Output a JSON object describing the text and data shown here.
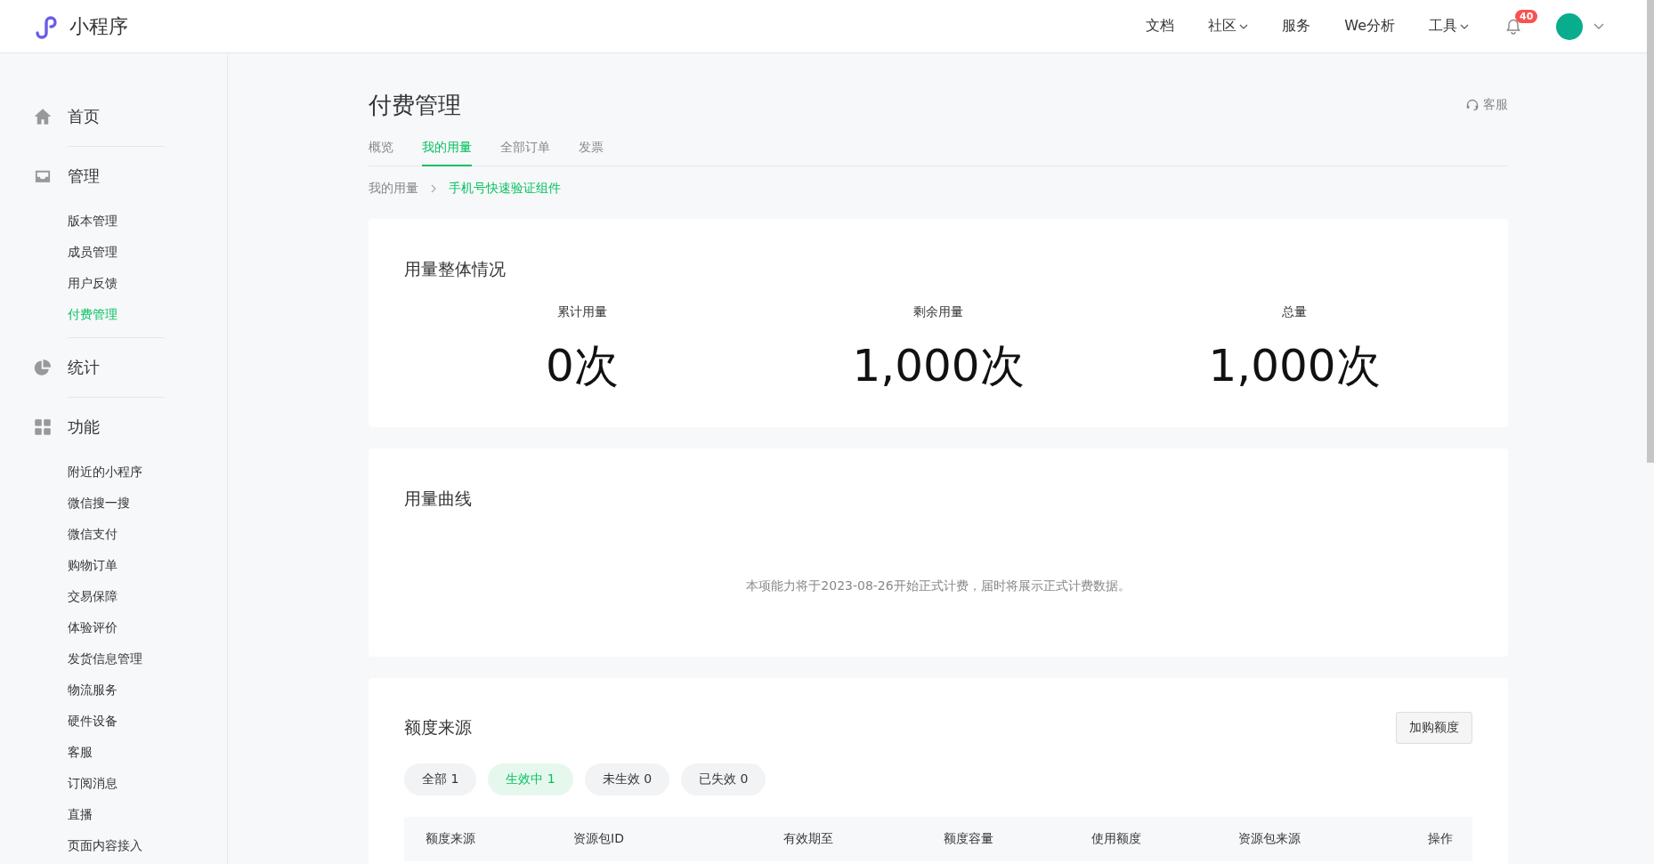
{
  "top_bar": {
    "brand": "小程序",
    "nav": [
      {
        "label": "文档",
        "has_menu": false
      },
      {
        "label": "社区",
        "has_menu": true
      },
      {
        "label": "服务",
        "has_menu": false
      },
      {
        "label": "We分析",
        "has_menu": false
      },
      {
        "label": "工具",
        "has_menu": true
      }
    ],
    "notification_count": "40"
  },
  "sidebar": {
    "sections": [
      {
        "label": "首页",
        "selected": false
      },
      {
        "label": "管理",
        "selected": false,
        "items": [
          {
            "label": "版本管理",
            "selected": false
          },
          {
            "label": "成员管理",
            "selected": false
          },
          {
            "label": "用户反馈",
            "selected": false
          },
          {
            "label": "付费管理",
            "selected": true
          }
        ]
      },
      {
        "label": "统计",
        "selected": false
      },
      {
        "label": "功能",
        "selected": false,
        "items": [
          {
            "label": "附近的小程序",
            "selected": false
          },
          {
            "label": "微信搜一搜",
            "selected": false
          },
          {
            "label": "微信支付",
            "selected": false
          },
          {
            "label": "购物订单",
            "selected": false
          },
          {
            "label": "交易保障",
            "selected": false
          },
          {
            "label": "体验评价",
            "selected": false
          },
          {
            "label": "发货信息管理",
            "selected": false
          },
          {
            "label": "物流服务",
            "selected": false
          },
          {
            "label": "硬件设备",
            "selected": false
          },
          {
            "label": "客服",
            "selected": false
          },
          {
            "label": "订阅消息",
            "selected": false
          },
          {
            "label": "直播",
            "selected": false
          },
          {
            "label": "页面内容接入",
            "selected": false
          }
        ]
      }
    ]
  },
  "page": {
    "title": "付费管理",
    "support_link": "客服",
    "tabs": [
      {
        "label": "概览",
        "selected": false
      },
      {
        "label": "我的用量",
        "selected": true
      },
      {
        "label": "全部订单",
        "selected": false
      },
      {
        "label": "发票",
        "selected": false
      }
    ],
    "breadcrumb": [
      "我的用量",
      "手机号快速验证组件"
    ],
    "usage_overview": {
      "title": "用量整体情况",
      "stats": [
        {
          "label": "累计用量",
          "value": "0次"
        },
        {
          "label": "剩余用量",
          "value": "1,000次"
        },
        {
          "label": "总量",
          "value": "1,000次"
        }
      ]
    },
    "usage_curve": {
      "title": "用量曲线",
      "note": "本项能力将于2023-08-26开始正式计费，届时将展示正式计费数据。"
    },
    "quota_sources": {
      "title": "额度来源",
      "button": "加购额度",
      "filters": [
        {
          "label": "全部 1",
          "selected": false
        },
        {
          "label": "生效中 1",
          "selected": true
        },
        {
          "label": "未生效 0",
          "selected": false
        },
        {
          "label": "已失效 0",
          "selected": false
        }
      ],
      "table": {
        "columns": [
          "额度来源",
          "资源包ID",
          "有效期至",
          "额度容量",
          "使用额度",
          "资源包来源",
          "操作"
        ]
      }
    }
  }
}
